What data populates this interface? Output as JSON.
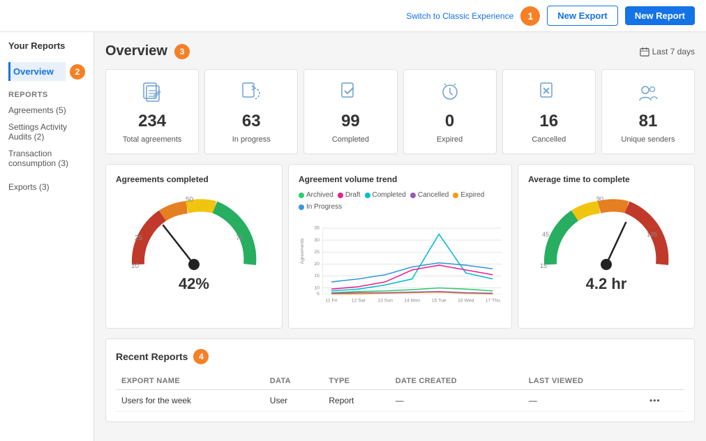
{
  "topbar": {
    "switch_label": "Switch to Classic Experience",
    "new_export_label": "New Export",
    "new_report_label": "New Report",
    "badge1": "1"
  },
  "sidebar": {
    "app_title": "Your Reports",
    "overview_label": "Overview",
    "badge2": "2",
    "reports_section": "REPORTS",
    "items": [
      {
        "label": "Agreements (5)",
        "id": "agreements"
      },
      {
        "label": "Settings Activity Audits (2)",
        "id": "settings"
      },
      {
        "label": "Transaction consumption (3)",
        "id": "transaction"
      }
    ],
    "exports_label": "Exports (3)"
  },
  "overview": {
    "title": "Overview",
    "badge3": "3",
    "date_range": "Last 7 days",
    "stats": [
      {
        "number": "234",
        "label": "Total agreements",
        "icon": "agreements-icon"
      },
      {
        "number": "63",
        "label": "In progress",
        "icon": "inprogress-icon"
      },
      {
        "number": "99",
        "label": "Completed",
        "icon": "completed-icon"
      },
      {
        "number": "0",
        "label": "Expired",
        "icon": "expired-icon"
      },
      {
        "number": "16",
        "label": "Cancelled",
        "icon": "cancelled-icon"
      },
      {
        "number": "81",
        "label": "Unique senders",
        "icon": "senders-icon"
      }
    ]
  },
  "charts": {
    "agreements_completed": {
      "title": "Agreements completed",
      "value": "42%",
      "gauge_min": 0,
      "gauge_max": 100,
      "gauge_current": 42
    },
    "volume_trend": {
      "title": "Agreement volume trend",
      "legend": [
        {
          "label": "Archived",
          "color": "#2ecc71"
        },
        {
          "label": "Draft",
          "color": "#e91e8c"
        },
        {
          "label": "Completed",
          "color": "#00bcd4"
        },
        {
          "label": "Cancelled",
          "color": "#9b59b6"
        },
        {
          "label": "Expired",
          "color": "#f39c12"
        },
        {
          "label": "In Progress",
          "color": "#3498db"
        }
      ],
      "x_labels": [
        "11 Fri",
        "12 Sat",
        "13 Sun",
        "14 Mon",
        "15 Tue",
        "16 Wed",
        "17 Thu"
      ],
      "y_label": "Agreements"
    },
    "avg_time": {
      "title": "Average time to complete",
      "value": "4.2 hr",
      "gauge_min": 0,
      "gauge_max": 180
    }
  },
  "recent_reports": {
    "title": "Recent Reports",
    "badge4": "4",
    "columns": [
      "EXPORT NAME",
      "DATA",
      "TYPE",
      "DATE CREATED",
      "LAST VIEWED",
      ""
    ],
    "rows": [
      {
        "export_name": "Users for the week",
        "data": "User",
        "type": "Report",
        "date_created": "—",
        "last_viewed": "—"
      }
    ]
  }
}
